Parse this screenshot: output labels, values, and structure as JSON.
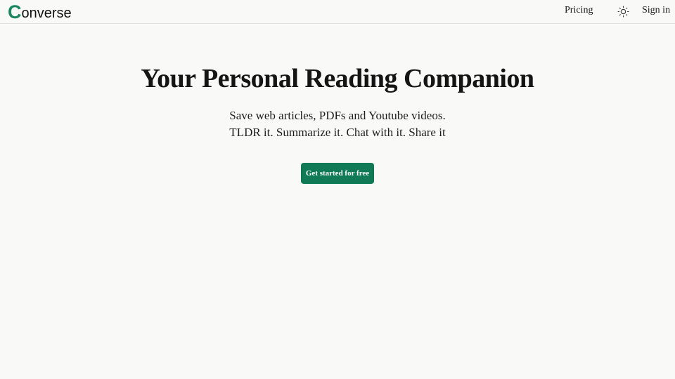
{
  "header": {
    "logo_initial": "C",
    "logo_rest": "onverse",
    "pricing_label": "Pricing",
    "theme_icon": "sun-icon",
    "signin_label": "Sign in"
  },
  "hero": {
    "title": "Your Personal Reading Companion",
    "subtitle_line1": "Save web articles, PDFs and Youtube videos.",
    "subtitle_line2": "TLDR it. Summarize it. Chat with it. Share it",
    "cta_label": "Get started for free"
  },
  "colors": {
    "accent": "#107a56",
    "logo_accent": "#16895f",
    "background": "#f9f9f8"
  }
}
